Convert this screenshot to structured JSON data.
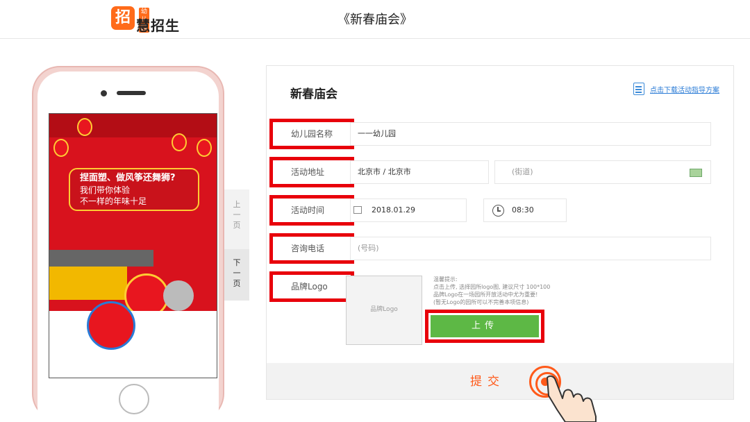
{
  "header": {
    "logo_char": "招",
    "logo_sub": "幼儿园",
    "logo_name": "慧招生",
    "title": "《新春庙会》"
  },
  "phone": {
    "bubble_line1": "捏面塑、做风筝还舞狮?",
    "bubble_line2": "我们带你体验",
    "bubble_line3": "不一样的年味十足"
  },
  "pager": {
    "prev_label": "上一页",
    "next_label": "下一页"
  },
  "form": {
    "title": "新春庙会",
    "download_link": "点击下载活动指导方案",
    "kindergarten": {
      "label": "幼儿园名称",
      "value": "一一幼儿园"
    },
    "address": {
      "label": "活动地址",
      "city": "北京市  /  北京市",
      "street_placeholder": "(街道)"
    },
    "time": {
      "label": "活动时间",
      "date": "2018.01.29",
      "clock": "08:30"
    },
    "phone": {
      "label": "咨询电话",
      "placeholder": "(号码)"
    },
    "logo": {
      "label": "品牌Logo",
      "box_text": "品牌Logo",
      "tips": [
        "温馨提示:",
        "点击上传, 选择园所logo图, 建议尺寸 100*100",
        "品牌Logo在一场园所开放活动中尤为重要!",
        "(暂无Logo的园所可以不完善本项信息)"
      ],
      "upload_label": "上传"
    },
    "submit_label": "提交"
  },
  "colors": {
    "accent": "#ff5a1a",
    "highlight": "#e8000b",
    "upload": "#5db845",
    "link": "#2a7bd6"
  }
}
